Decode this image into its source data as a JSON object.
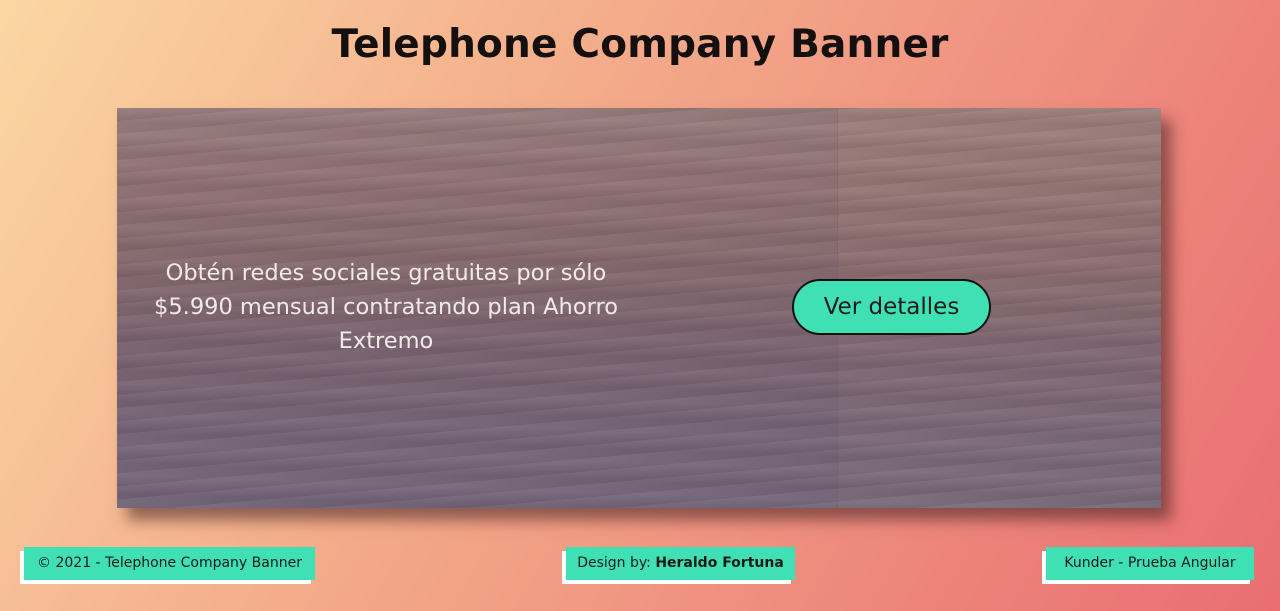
{
  "page": {
    "title": "Telephone Company Banner"
  },
  "banner": {
    "text": "Obtén redes sociales gratuitas por sólo $5.990 mensual contratando plan Ahorro Extremo",
    "button_label": "Ver detalles"
  },
  "footer": {
    "copyright": "© 2021 - Telephone Company Banner",
    "design_prefix": "Design by: ",
    "design_author": "Heraldo Fortuna",
    "right_label": "Kunder - Prueba Angular"
  },
  "colors": {
    "accent": "#3fe0b4",
    "title_text": "#141010",
    "background_start": "#fbd6a3",
    "background_end": "#e96e72"
  }
}
